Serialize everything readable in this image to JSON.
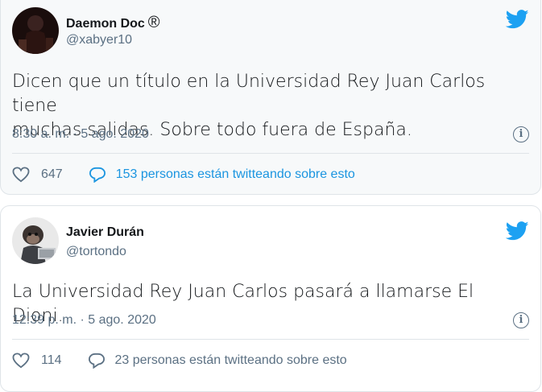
{
  "tweets": [
    {
      "name": "Daemon Doc",
      "name_suffix": "®",
      "handle": "@xabyer10",
      "text_line1": "Dicen que un título en la Universidad Rey Juan Carlos tiene",
      "text_line2": "muchas salidas. Sobre todo fuera de España.",
      "timestamp": "8:30 a. m. · 5 ago. 2020",
      "likes": "647",
      "conversation": "153 personas están twitteando sobre esto",
      "info_icon": "info-icon",
      "colors": {
        "conversation": "#1b95e0"
      }
    },
    {
      "name": "Javier Durán",
      "handle": "@tortondo",
      "text_line1": "La Universidad Rey Juan Carlos pasará a llamarse El Dioni.",
      "timestamp": "12:39 p. m. · 5 ago. 2020",
      "likes": "114",
      "conversation": "23 personas están twitteando sobre esto",
      "info_icon": "info-icon",
      "colors": {
        "conversation": "#5b7083"
      }
    }
  ],
  "colors": {
    "twitter_blue": "#1da1f2",
    "secondary_text": "#5b7083",
    "border": "#dfe4e8"
  }
}
